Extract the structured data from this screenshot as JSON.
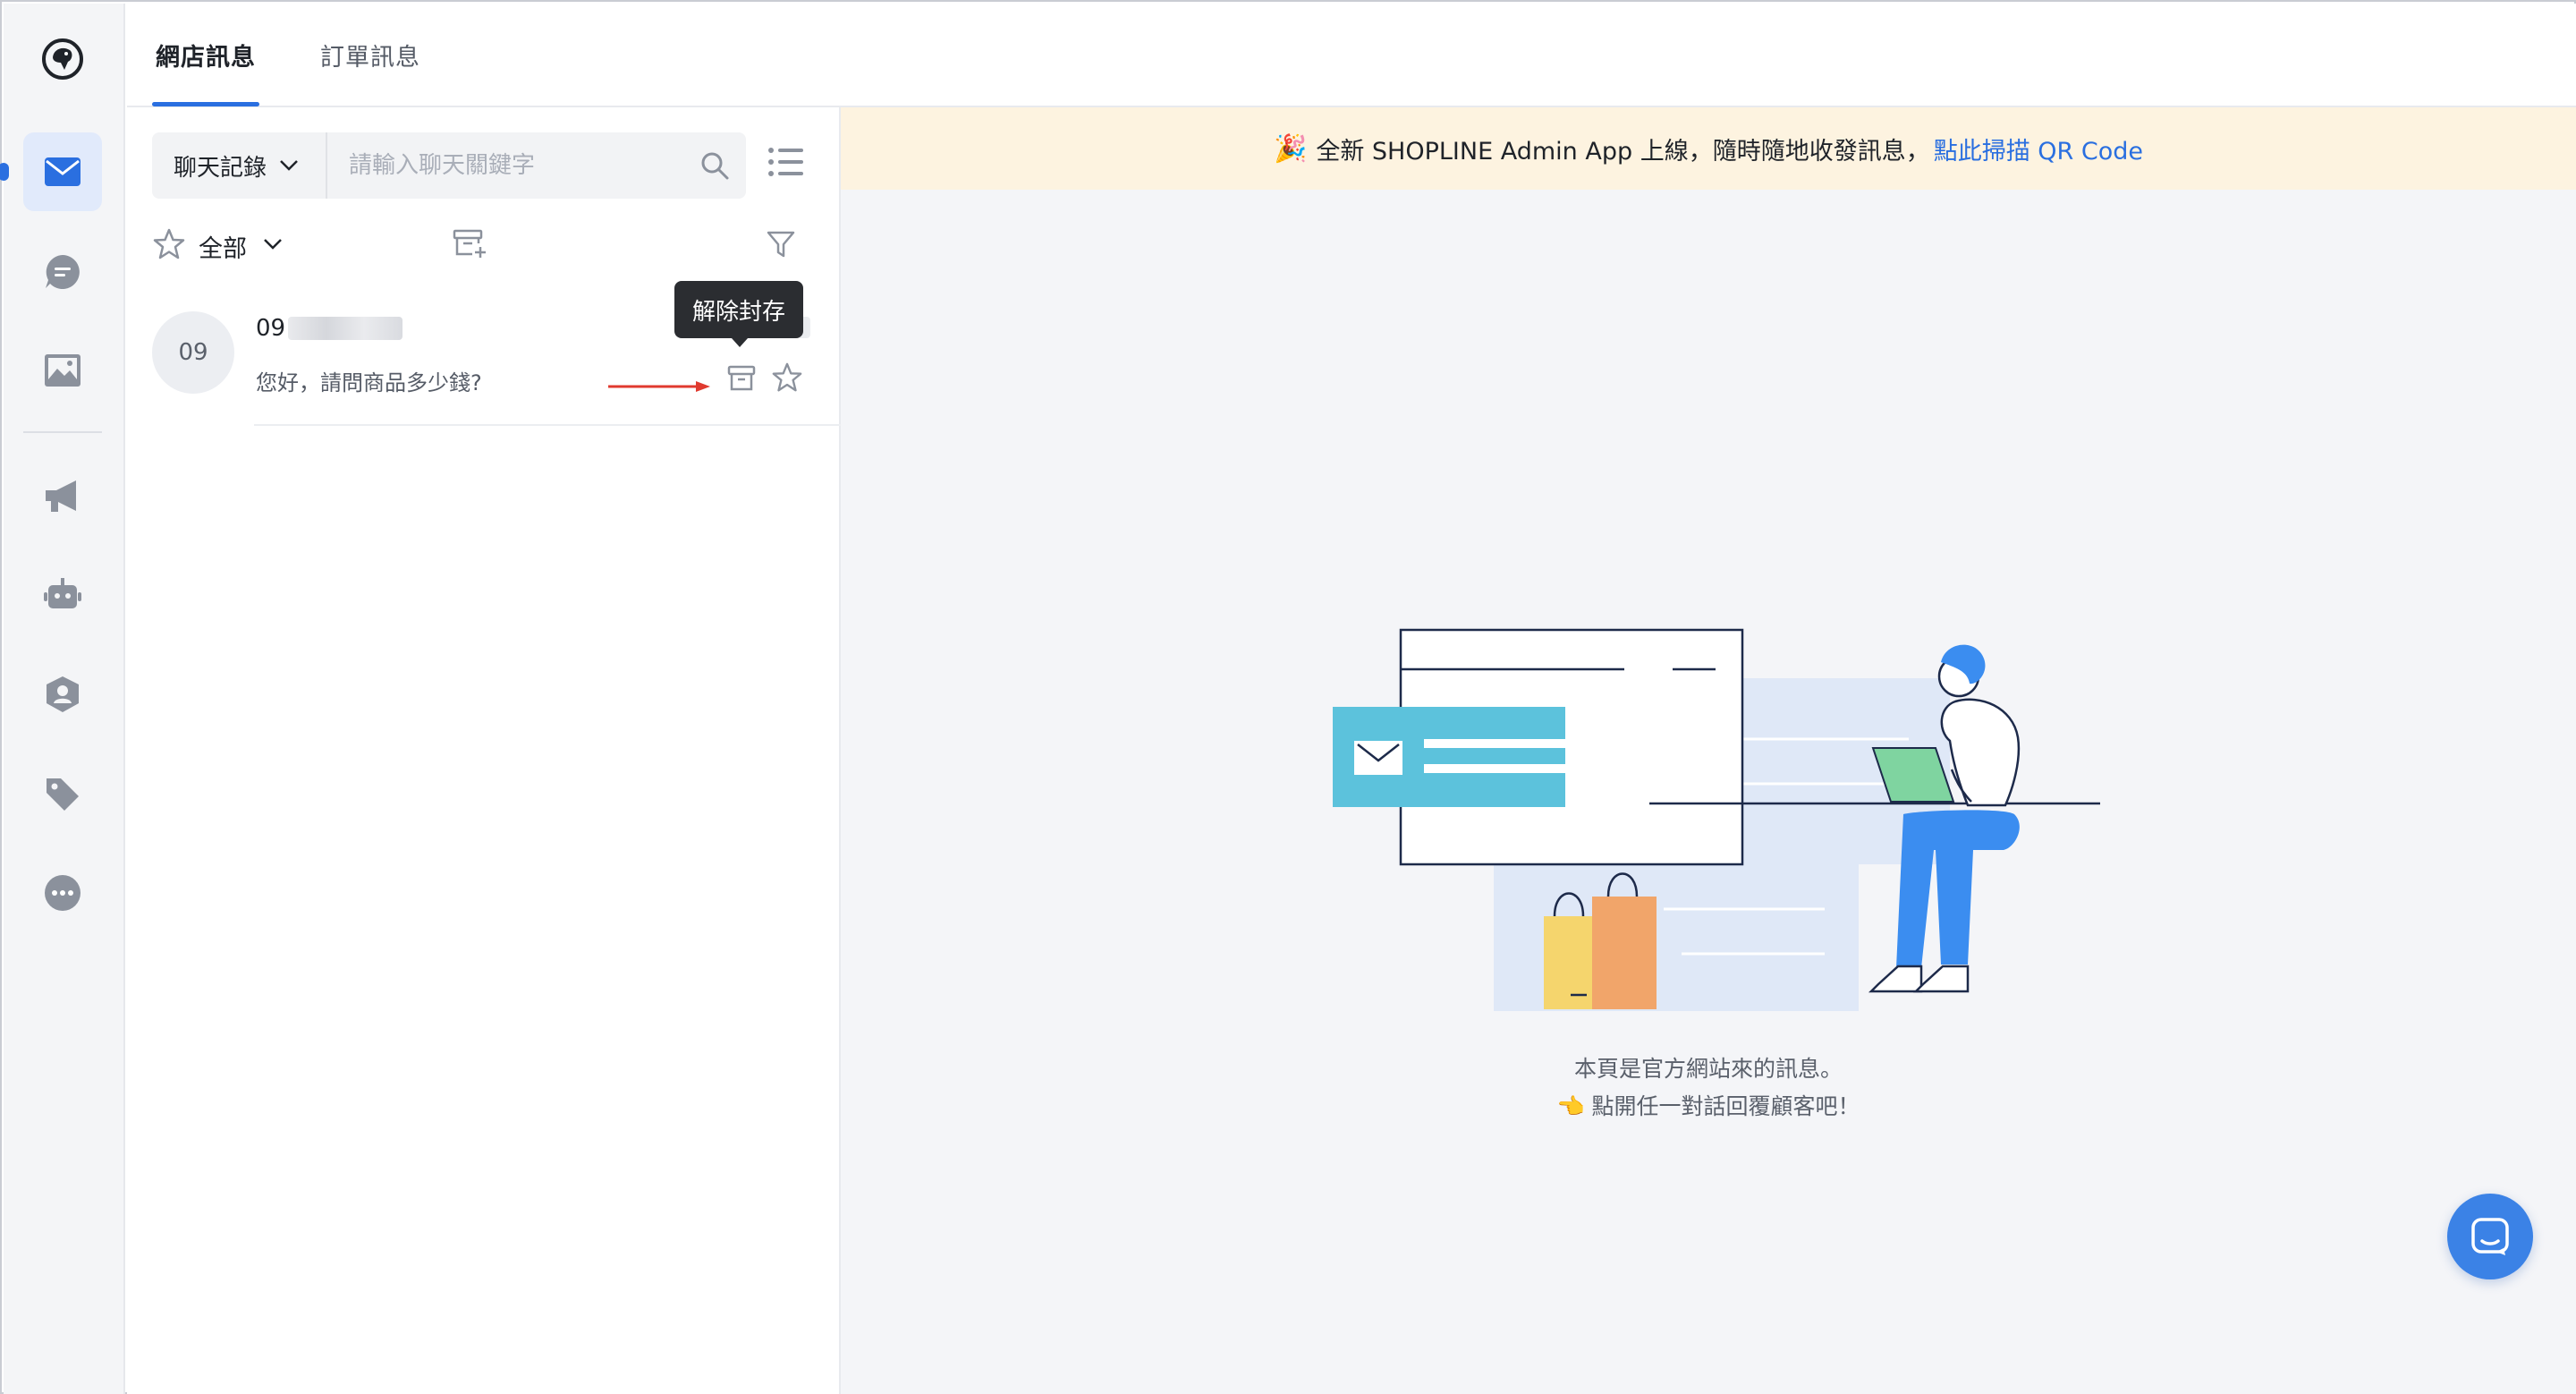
{
  "tabs": [
    {
      "label": "網店訊息"
    },
    {
      "label": "訂單訊息"
    }
  ],
  "search": {
    "type_label": "聊天記錄",
    "placeholder": "請輸入聊天關鍵字"
  },
  "filter": {
    "label": "全部"
  },
  "conversation": {
    "avatar_text": "09",
    "name_prefix": "09",
    "last_message": "您好，請問商品多少錢?"
  },
  "tooltip": {
    "text": "解除封存"
  },
  "banner": {
    "text": "全新 SHOPLINE Admin App 上線，隨時隨地收發訊息，",
    "link": "點此掃描 QR Code"
  },
  "empty_state": {
    "line1": "本頁是官方網站來的訊息。",
    "line2": "👈 點開任一對話回覆顧客吧！"
  },
  "colors": {
    "accent": "#2a6fe0",
    "banner_bg": "#fdf3e0",
    "arrow": "#e03a2f"
  },
  "sidebar": {
    "items": [
      {
        "icon": "mail-icon"
      },
      {
        "icon": "chat-icon"
      },
      {
        "icon": "image-icon"
      },
      {
        "icon": "megaphone-icon"
      },
      {
        "icon": "robot-icon"
      },
      {
        "icon": "user-shield-icon"
      },
      {
        "icon": "tag-icon"
      },
      {
        "icon": "more-icon"
      }
    ]
  }
}
